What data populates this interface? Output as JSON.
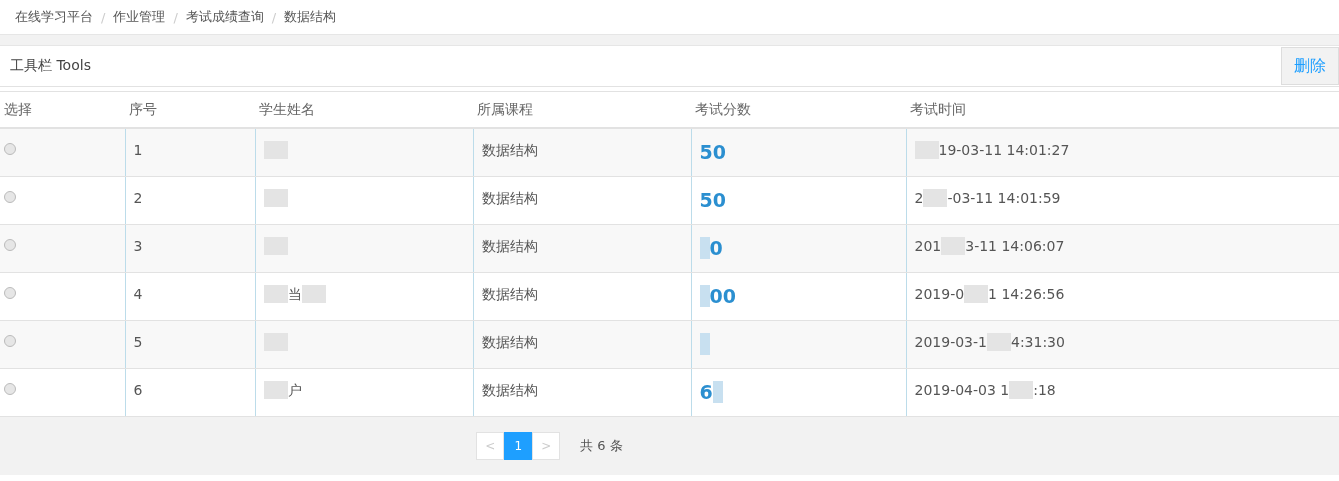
{
  "breadcrumb": [
    {
      "label": "在线学习平台"
    },
    {
      "label": "作业管理",
      "separator": "/"
    },
    {
      "label": "考试成绩查询",
      "separator": "/"
    },
    {
      "label": "数据结构",
      "separator": "/"
    }
  ],
  "toolbar": {
    "title": "工具栏 Tools",
    "buttons": [
      {
        "label": "删除"
      }
    ]
  },
  "table": {
    "columns": [
      "选择",
      "序号",
      "学生姓名",
      "所属课程",
      "考试分数",
      "考试时间"
    ],
    "rows": [
      {
        "selected": false,
        "index": "1",
        "name": [
          {
            "kind": "redacted"
          }
        ],
        "course": "数据结构",
        "score": [
          {
            "kind": "text",
            "text": "50"
          }
        ],
        "time": [
          {
            "kind": "redacted"
          },
          {
            "kind": "text",
            "text": "19-03-11 14:01:27"
          }
        ]
      },
      {
        "selected": false,
        "index": "2",
        "name": [
          {
            "kind": "redacted"
          }
        ],
        "course": "数据结构",
        "score": [
          {
            "kind": "text",
            "text": "50"
          }
        ],
        "time": [
          {
            "kind": "text",
            "text": "2"
          },
          {
            "kind": "redacted"
          },
          {
            "kind": "text",
            "text": "-03-11 14:01:59"
          }
        ]
      },
      {
        "selected": false,
        "index": "3",
        "name": [
          {
            "kind": "redacted"
          }
        ],
        "course": "数据结构",
        "score": [
          {
            "kind": "redacted"
          },
          {
            "kind": "text",
            "text": "0"
          }
        ],
        "time": [
          {
            "kind": "text",
            "text": "201"
          },
          {
            "kind": "redacted"
          },
          {
            "kind": "text",
            "text": "3-11 14:06:07"
          }
        ]
      },
      {
        "selected": false,
        "index": "4",
        "name": [
          {
            "kind": "redacted"
          },
          {
            "kind": "text",
            "text": "当"
          },
          {
            "kind": "redacted"
          }
        ],
        "course": "数据结构",
        "score": [
          {
            "kind": "redacted"
          },
          {
            "kind": "text",
            "text": "00"
          }
        ],
        "time": [
          {
            "kind": "text",
            "text": "2019-0"
          },
          {
            "kind": "redacted"
          },
          {
            "kind": "text",
            "text": "1 14:26:56"
          }
        ]
      },
      {
        "selected": false,
        "index": "5",
        "name": [
          {
            "kind": "redacted"
          }
        ],
        "course": "数据结构",
        "score": [
          {
            "kind": "redacted"
          }
        ],
        "time": [
          {
            "kind": "text",
            "text": "2019-03-1"
          },
          {
            "kind": "redacted"
          },
          {
            "kind": "text",
            "text": "4:31:30"
          }
        ]
      },
      {
        "selected": false,
        "index": "6",
        "name": [
          {
            "kind": "redacted"
          },
          {
            "kind": "text",
            "text": "户"
          }
        ],
        "course": "数据结构",
        "score": [
          {
            "kind": "text",
            "text": "6"
          },
          {
            "kind": "redacted"
          }
        ],
        "time": [
          {
            "kind": "text",
            "text": "2019-04-03 1"
          },
          {
            "kind": "redacted"
          },
          {
            "kind": "text",
            "text": ":18"
          }
        ]
      }
    ]
  },
  "pagination": {
    "prev": "<",
    "pages": [
      {
        "label": "1",
        "selected": true
      }
    ],
    "next": ">",
    "total": "共 6 条"
  }
}
